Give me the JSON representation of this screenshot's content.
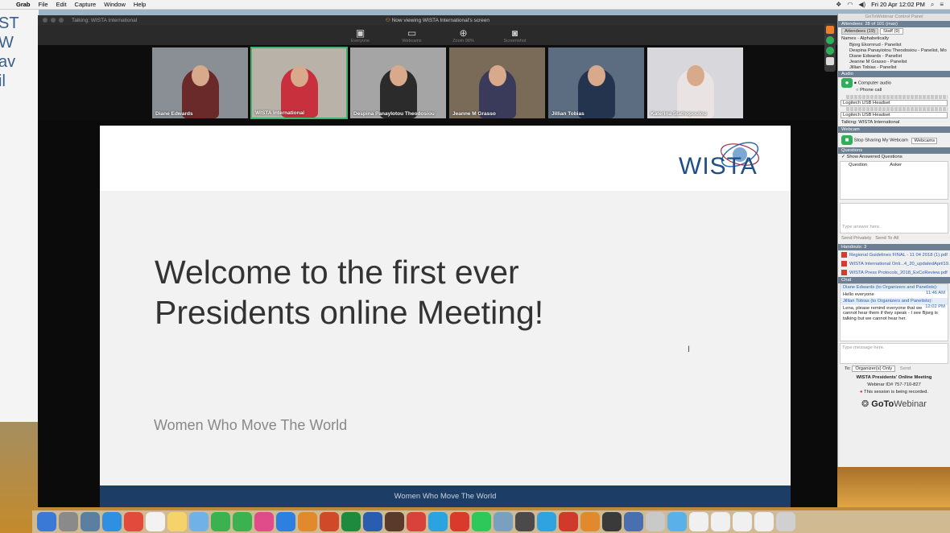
{
  "menubar": {
    "app": "Grab",
    "items": [
      "File",
      "Edit",
      "Capture",
      "Window",
      "Help"
    ],
    "clock": "Fri 20 Apr 12:02 PM"
  },
  "viewer": {
    "window_title": "Talking: WISTA International",
    "viewing_banner": "Now viewing WISTA International's screen",
    "toolbar": [
      {
        "label": "Everyone",
        "icon": "grid-icon"
      },
      {
        "label": "Webcams",
        "icon": "camera-icon"
      },
      {
        "label": "Zoom 98%",
        "icon": "zoom-icon"
      },
      {
        "label": "Screenshot",
        "icon": "screenshot-icon"
      }
    ],
    "webcams": [
      {
        "name": "Diane Edwards",
        "bg": "#8a8f96",
        "shirt": "#6b2a2a"
      },
      {
        "name": "WISTA International",
        "bg": "#b9b2a8",
        "shirt": "#c7303c"
      },
      {
        "name": "Despina Panaylotou Theodosiou",
        "bg": "#a5a5a5",
        "shirt": "#2b2b2b"
      },
      {
        "name": "Jeanne M Grasso",
        "bg": "#7a6a58",
        "shirt": "#3a3a5a"
      },
      {
        "name": "Jillian Tobias",
        "bg": "#5c6d82",
        "shirt": "#24344f"
      },
      {
        "name": "Katerina Stathopoulou",
        "bg": "#d8d8dc",
        "shirt": "#e9e3e3"
      }
    ]
  },
  "slide": {
    "logo": "WISTA",
    "headline_line1": "Welcome to the first ever",
    "headline_line2": "Presidents online Meeting!",
    "tagline": "Women Who Move The World",
    "footer": "Women Who Move The World"
  },
  "panel": {
    "title": "GoToWebinar Control Panel",
    "attendees_header": "Attendees: 28 of 101 (max)",
    "tab_attendees": "Attendees (19)",
    "tab_staff": "Staff (9)",
    "sort_label": "Names - Alphabetically",
    "attendees": [
      "Bjorg Ekornrud - Panelist",
      "Despina Panayiotou Theodosiou - Panelist, Mo",
      "Diane Edwards - Panelist",
      "Jeanne M Grasso - Panelist",
      "Jillian Tobias - Panelist"
    ],
    "audio_header": "Audio",
    "audio_computer": "Computer audio",
    "audio_phone": "Phone call",
    "mic_device": "Logitech USB Headset",
    "speaker_device": "Logitech USB Headset",
    "talking": "Talking: WISTA International",
    "webcam_header": "Webcam",
    "stop_webcam": "Stop Sharing My Webcam",
    "webcams_btn": "Webcams",
    "questions_header": "Questions",
    "show_answered": "Show Answered Questions",
    "col_question": "Question",
    "col_asker": "Asker",
    "answer_placeholder": "Type answer here.",
    "send_privately": "Send Privately",
    "send_to_all": "Send To All",
    "handouts_header": "Handouts: 3",
    "handouts": [
      "Regional Guidelines FINAL - 11 04 2018 (1).pdf",
      "WISTA International Onli...4_20_updatedApril19.p",
      "WISTA Press Protocols_2018_ExCoReview.pdf"
    ],
    "chat_header": "Chat",
    "chat": [
      {
        "from": "Diane Edwards (to Organizers and Panelists):",
        "time": "11:46 AM",
        "text": "Hello everyone"
      },
      {
        "from": "Jillian Tobias (to Organizers and Panelists):",
        "time": "12:02 PM",
        "text": "Lena, please remind everyone that we cannot hear them if they speak - I see Bjorg is talking but we cannot hear her."
      }
    ],
    "chat_placeholder": "Type message here.",
    "to_label": "To:",
    "to_value": "Organizer(s) Only",
    "send_label": "Send",
    "meeting_name": "WISTA Presidents' Online Meeting",
    "webinar_id": "Webinar ID# 757-710-827",
    "recording": "This session is being recorded.",
    "brand_bold": "GoTo",
    "brand_light": "Webinar"
  },
  "colors": {
    "panel_section": "#6c7f93",
    "active_cam": "#3cb46e",
    "slide_footer": "#1c3d66",
    "wista_blue": "#1f4f86"
  },
  "dock_colors": [
    "#3b79d6",
    "#8a8a8a",
    "#5a7fa0",
    "#2f8fe0",
    "#e24a3b",
    "#f2f2f2",
    "#f5d36a",
    "#70b2e8",
    "#3bb24f",
    "#3bb24f",
    "#e04c8a",
    "#2d7fe0",
    "#e08a2d",
    "#d04a2a",
    "#1e8a3e",
    "#2a5db0",
    "#5a3a2a",
    "#d9423a",
    "#2aa3e0",
    "#d93a2b",
    "#2ec75a",
    "#7aa0c0",
    "#4a4a4a",
    "#2fa3e0",
    "#d03a2a",
    "#e08a2d",
    "#3a3a3a",
    "#4a6fb0",
    "#c9c9c9",
    "#5ab0e8",
    "#f0f0f0",
    "#f0f0f0",
    "#f0f0f0",
    "#f0f0f0",
    "#d0d0d0"
  ]
}
